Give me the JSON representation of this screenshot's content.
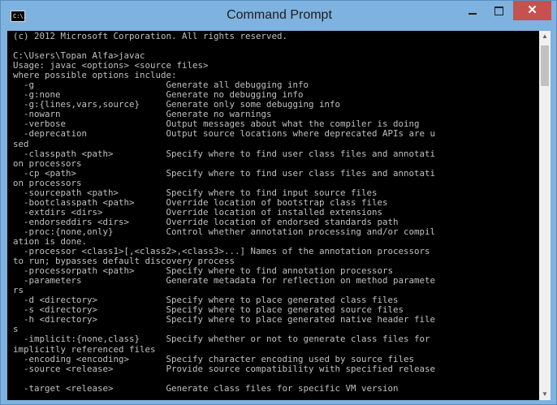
{
  "window": {
    "title": "Command Prompt",
    "icon_label": "C:\\.",
    "close_glyph": "✕"
  },
  "console": {
    "lines": [
      "(c) 2012 Microsoft Corporation. All rights reserved.",
      "",
      "C:\\Users\\Topan Alfa>javac",
      "Usage: javac <options> <source files>",
      "where possible options include:",
      "  -g                         Generate all debugging info",
      "  -g:none                    Generate no debugging info",
      "  -g:{lines,vars,source}     Generate only some debugging info",
      "  -nowarn                    Generate no warnings",
      "  -verbose                   Output messages about what the compiler is doing",
      "  -deprecation               Output source locations where deprecated APIs are u",
      "sed",
      "  -classpath <path>          Specify where to find user class files and annotati",
      "on processors",
      "  -cp <path>                 Specify where to find user class files and annotati",
      "on processors",
      "  -sourcepath <path>         Specify where to find input source files",
      "  -bootclasspath <path>      Override location of bootstrap class files",
      "  -extdirs <dirs>            Override location of installed extensions",
      "  -endorseddirs <dirs>       Override location of endorsed standards path",
      "  -proc:{none,only}          Control whether annotation processing and/or compil",
      "ation is done.",
      "  -processor <class1>[,<class2>,<class3>...] Names of the annotation processors",
      "to run; bypasses default discovery process",
      "  -processorpath <path>      Specify where to find annotation processors",
      "  -parameters                Generate metadata for reflection on method paramete",
      "rs",
      "  -d <directory>             Specify where to place generated class files",
      "  -s <directory>             Specify where to place generated source files",
      "  -h <directory>             Specify where to place generated native header file",
      "s",
      "  -implicit:{none,class}     Specify whether or not to generate class files for",
      "implicitly referenced files",
      "  -encoding <encoding>       Specify character encoding used by source files",
      "  -source <release>          Provide source compatibility with specified release",
      "",
      "  -target <release>          Generate class files for specific VM version"
    ]
  },
  "scrollbar": {
    "up_glyph": "▲",
    "down_glyph": "▼"
  }
}
